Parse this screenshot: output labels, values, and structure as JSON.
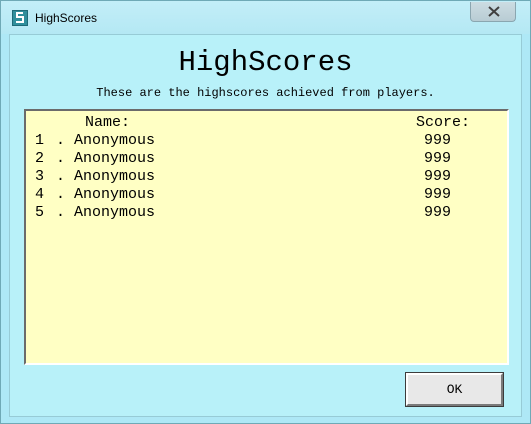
{
  "window": {
    "title": "HighScores"
  },
  "dialog": {
    "heading": "HighScores",
    "subheading": "These are the highscores achieved from players.",
    "columns": {
      "name": "Name:",
      "score": "Score:"
    },
    "rows": [
      {
        "rank": "1",
        "sep": ".",
        "name": "Anonymous",
        "score": "999"
      },
      {
        "rank": "2",
        "sep": ".",
        "name": "Anonymous",
        "score": "999"
      },
      {
        "rank": "3",
        "sep": ".",
        "name": "Anonymous",
        "score": "999"
      },
      {
        "rank": "4",
        "sep": ".",
        "name": "Anonymous",
        "score": "999"
      },
      {
        "rank": "5",
        "sep": ".",
        "name": "Anonymous",
        "score": "999"
      }
    ],
    "ok_label": "OK"
  },
  "icons": {
    "app": "snake-app-icon",
    "close": "close-icon"
  },
  "colors": {
    "window_bg": "#aee8f6",
    "client_bg": "#b8f1f9",
    "panel_bg": "#ffffc4"
  }
}
